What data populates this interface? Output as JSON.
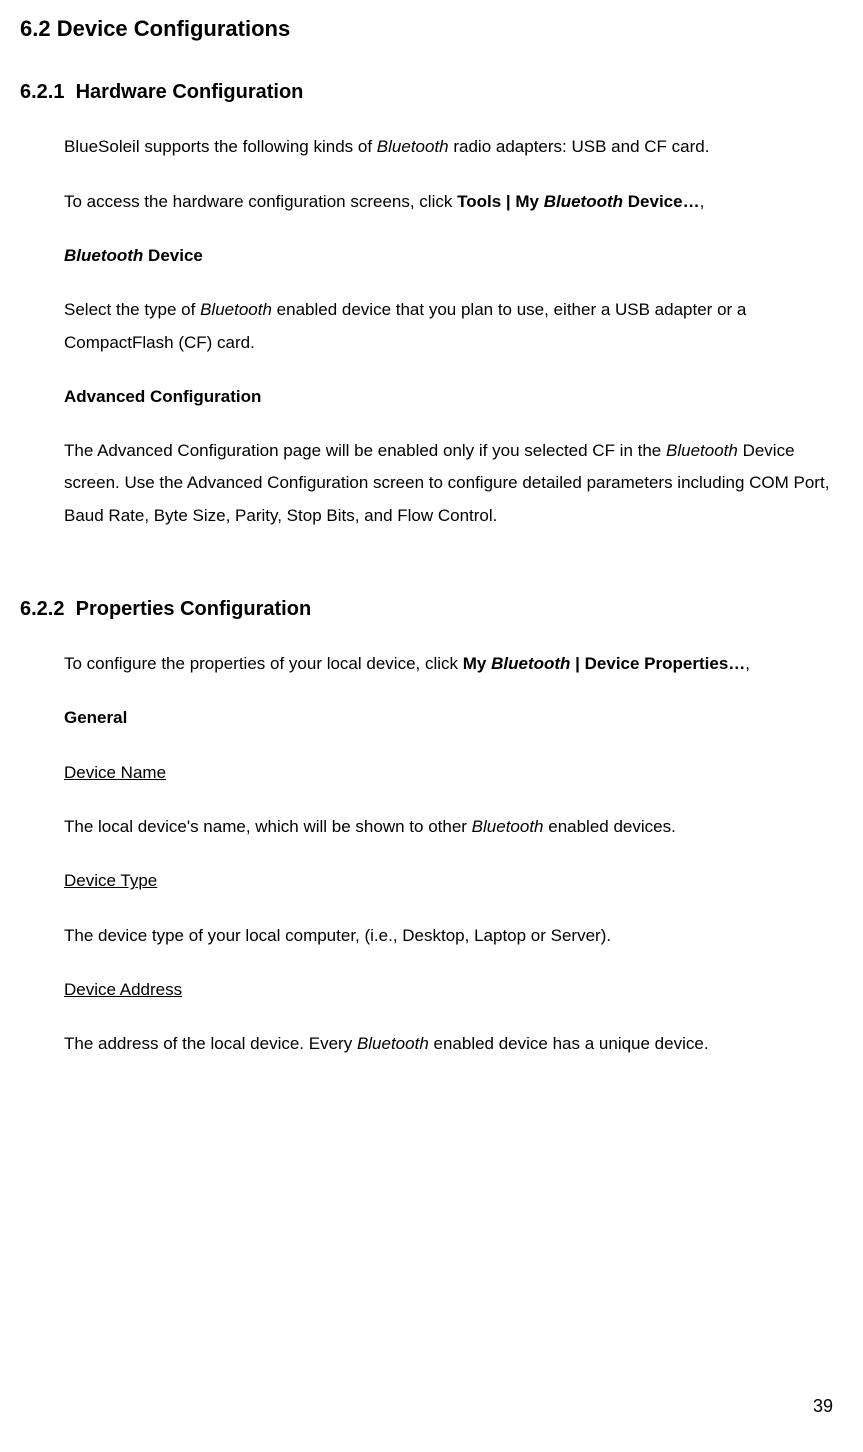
{
  "section1": {
    "number": "6.2",
    "title": "Device Configurations"
  },
  "section1_1": {
    "number": "6.2.1",
    "title": "Hardware Configuration",
    "para1_a": "BlueSoleil supports the following kinds of ",
    "para1_b": "Bluetooth",
    "para1_c": " radio adapters: USB and CF card.",
    "para2_a": "To access the hardware configuration screens, click ",
    "para2_b": "Tools | My ",
    "para2_c": "Bluetooth",
    "para2_d": " Device…",
    "para2_e": ",",
    "sub1_title_a": "Bluetooth",
    "sub1_title_b": " Device",
    "sub1_para_a": "Select the type of ",
    "sub1_para_b": "Bluetooth",
    "sub1_para_c": " enabled device that you plan to use, either a USB adapter or a CompactFlash (CF) card.",
    "sub2_title": "Advanced Configuration",
    "sub2_para_a": "The Advanced Configuration page will be enabled only if you selected CF in the ",
    "sub2_para_b": "Bluetooth",
    "sub2_para_c": " Device screen. Use the Advanced Configuration screen to configure detailed parameters including COM Port, Baud Rate, Byte Size, Parity, Stop Bits, and Flow Control."
  },
  "section1_2": {
    "number": "6.2.2",
    "title": "Properties Configuration",
    "para1_a": "To configure the properties of your local device, click ",
    "para1_b": "My ",
    "para1_c": "Bluetooth",
    "para1_d": " | Device Properties…",
    "para1_e": ",",
    "sub1_title": "General",
    "item1_title": "Device Name",
    "item1_para_a": "The local device's name, which will be shown to other ",
    "item1_para_b": "Bluetooth",
    "item1_para_c": " enabled devices.",
    "item2_title": "Device Type",
    "item2_para": "The device type of your local computer, (i.e., Desktop, Laptop or Server).",
    "item3_title": "Device Address",
    "item3_para_a": "The address of the local device. Every ",
    "item3_para_b": "Bluetooth",
    "item3_para_c": " enabled device has a unique device."
  },
  "page_number": "39"
}
